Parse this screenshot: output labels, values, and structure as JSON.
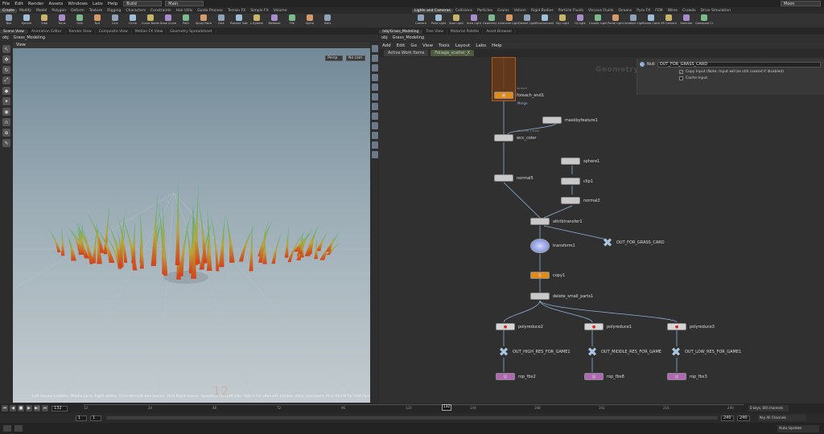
{
  "menubar": {
    "items": [
      "File",
      "Edit",
      "Render",
      "Assets",
      "Windows",
      "Labs",
      "Help"
    ],
    "build_label": "Build",
    "main_label": "Main",
    "user_label": "Moon"
  },
  "shelf_left": {
    "tabs": [
      "Create",
      "Modify",
      "Model",
      "Polygon",
      "Deform",
      "Texture",
      "Rigging",
      "Characters",
      "Constraints",
      "Hair Utils",
      "Guide Process",
      "Terrain FX",
      "Simple FX",
      "Volume"
    ],
    "active_tab": 0,
    "tools": [
      "Box",
      "Sphere",
      "Tube",
      "Torus",
      "Grid",
      "Null",
      "Line",
      "Circle",
      "Curve Bezier",
      "Draw Curve",
      "Path",
      "Spray Paint",
      "Font",
      "Platonic Solids",
      "L-System",
      "Metaball",
      "File",
      "Spiral",
      "Helix"
    ]
  },
  "shelf_right": {
    "tabs": [
      "Lights and Cameras",
      "Collisions",
      "Particles",
      "Grains",
      "Vellum",
      "Rigid Bodies",
      "Particle Fluids",
      "Viscous Fluids",
      "Oceans",
      "Pyro FX",
      "FEM",
      "Wires",
      "Crowds",
      "Drive Simulation"
    ],
    "active_tab": 0,
    "tools": [
      "Camera",
      "Point Light",
      "Spot Light",
      "Area Light",
      "Geometry Light",
      "Volume Light",
      "Distant Light",
      "Environment Light",
      "Sky Light",
      "GI Light",
      "Caustic Light",
      "Portal Light",
      "Ambient Light",
      "Stereo Camera",
      "VR Camera",
      "Switcher",
      "Gamepad Camera"
    ]
  },
  "left_pane": {
    "tabs": [
      "Scene View",
      "Animation Editor",
      "Render View",
      "Composite View",
      "Motion FX View",
      "Geometry Spreadsheet"
    ],
    "active_tab": 0,
    "path": [
      "obj",
      "Grass_Modeling"
    ],
    "view_label": "View",
    "persp_label": "Persp",
    "cam_label": "No cam",
    "status": "Left mouse tumbles. Middle pans. Right dollies. Ctrl+Alt+Left box-zooms. Ctrl+Right zooms. Spacebar-Ctrl-Left tilts. Hold L for alternate tumble, dolly, and zoom.    M or Alt+M for First Person Navigation.",
    "grid_number": "12"
  },
  "right_pane": {
    "tabs": [
      "/obj/Grass_Modeling",
      "Tree View",
      "Material Palette",
      "Asset Browser"
    ],
    "active_tab": 0,
    "path": [
      "obj",
      "Grass_Modeling"
    ],
    "menu": [
      "Add",
      "Edit",
      "Go",
      "View",
      "Tools",
      "Layout",
      "Labs",
      "Help"
    ],
    "work_items_label": "Active Work Items",
    "foliage_tab": "Foliage_scatter_X",
    "context_label": "Geometry"
  },
  "parm_panel": {
    "node_type": "Null",
    "node_name": "OUT_FOR_GRASS_CARD",
    "copy_input_label": "Copy Input (Note: Input will be still cooked if disabled)",
    "copy_input_checked": true,
    "cache_input_label": "Cache Input",
    "cache_input_checked": false
  },
  "nodes": {
    "foreach_end": {
      "name": "foreach_end1",
      "sub": "foreach",
      "badge": "Merge"
    },
    "maskbyfeature": {
      "name": "maskbyfeature1"
    },
    "wcc_color": {
      "name": "wcc_color",
      "sub": "attribute_create"
    },
    "normal": {
      "name": "normal5"
    },
    "sphere": {
      "name": "sphere1"
    },
    "clip": {
      "name": "clip1"
    },
    "normal2": {
      "name": "normal2"
    },
    "attribtransfer": {
      "name": "attribtransfer1"
    },
    "out_grass_card": {
      "name": "OUT_FOR_GRASS_CARD",
      "sub": "null"
    },
    "transform": {
      "name": "transform1"
    },
    "copy": {
      "name": "copy1"
    },
    "delete_small": {
      "name": "delete_small_parts1"
    },
    "polyreduce2": {
      "name": "polyreduce2"
    },
    "polyreduce1": {
      "name": "polyreduce1"
    },
    "polyreduce3": {
      "name": "polyreduce3"
    },
    "out_high": {
      "name": "OUT_HIGH_RES_FOR_GAME1",
      "sub": "null"
    },
    "out_mid": {
      "name": "OUT_MIDDLE_RES_FOR_GAME",
      "sub": "null"
    },
    "out_low": {
      "name": "OUT_LOW_RES_FOR_GAME1",
      "sub": "null"
    },
    "rop_fbx2": {
      "name": "rop_fbx2"
    },
    "rop_fbx": {
      "name": "rop_fbx8"
    },
    "rop_fbx3": {
      "name": "rop_fbx3"
    }
  },
  "timeline": {
    "current_frame": "132",
    "start": "1",
    "start2": "1",
    "end": "240",
    "end2": "240",
    "ticks": [
      "12",
      "24",
      "48",
      "72",
      "96",
      "120",
      "144",
      "168",
      "192",
      "216",
      "240"
    ],
    "keys_label": "0 keys, 0/0 channels",
    "key_all_label": "Key All Channels",
    "auto_update": "Auto Update"
  },
  "colors": {
    "accent": "#e28b18",
    "grass_tip": "#2fb58a",
    "grass_base": "#d2421c",
    "node_link": "#8fb2d6"
  }
}
